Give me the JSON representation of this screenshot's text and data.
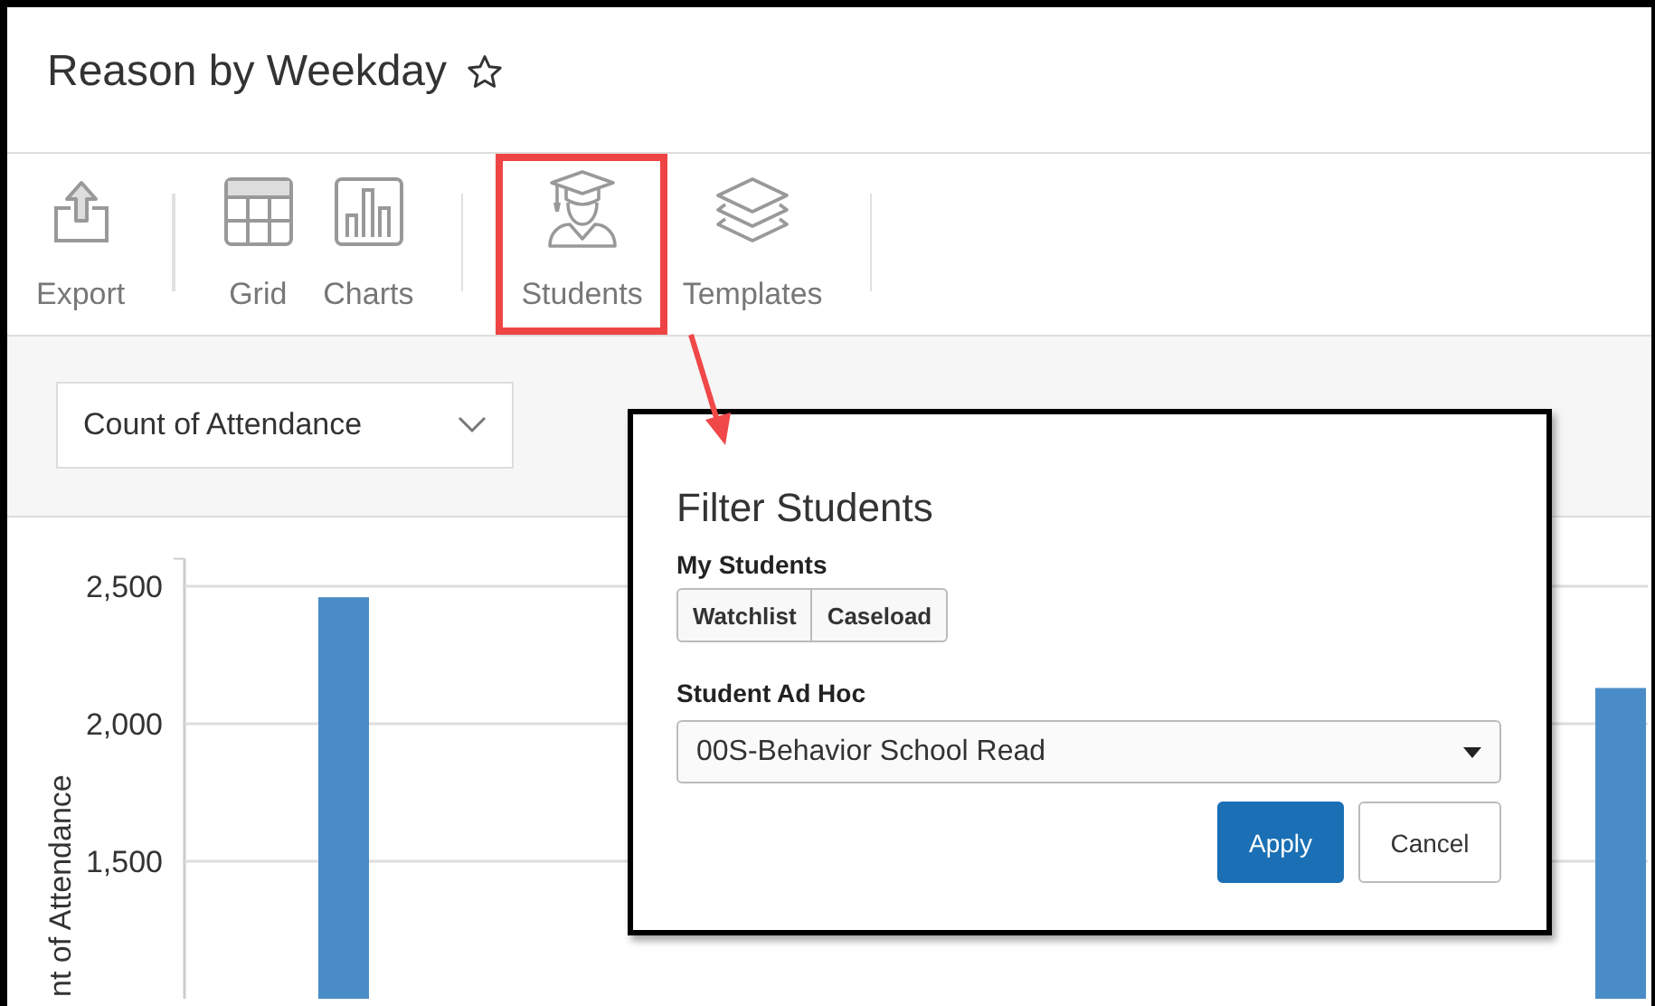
{
  "page": {
    "title": "Reason by Weekday",
    "favorite": false
  },
  "toolbar": {
    "items": [
      {
        "label": "Export",
        "kind": "export",
        "highlighted": false
      },
      {
        "label": "Grid",
        "kind": "grid",
        "highlighted": false
      },
      {
        "label": "Charts",
        "kind": "charts",
        "highlighted": false
      },
      {
        "label": "Students",
        "kind": "students",
        "highlighted": true
      },
      {
        "label": "Templates",
        "kind": "templates",
        "highlighted": false
      }
    ]
  },
  "measure_select": {
    "value": "Count of Attendance"
  },
  "chart": {
    "chart_data": {
      "type": "bar",
      "ylabel": "nt of Attendance",
      "values": [
        2460,
        null,
        2130
      ],
      "ylim": [
        1000,
        2600
      ],
      "grid": true,
      "yticks": [
        {
          "value": 1500,
          "label": "1,500"
        },
        {
          "value": 2000,
          "label": "2,000"
        },
        {
          "value": 2500,
          "label": "2,500"
        }
      ]
    }
  },
  "dialog": {
    "title": "Filter Students",
    "my_students_label": "My Students",
    "my_students_buttons": [
      "Watchlist",
      "Caseload"
    ],
    "ad_hoc_label": "Student Ad Hoc",
    "ad_hoc_value": "00S-Behavior School Read",
    "buttons": [
      {
        "label": "Apply",
        "kind": "primary"
      },
      {
        "label": "Cancel",
        "kind": "secondary"
      }
    ]
  }
}
